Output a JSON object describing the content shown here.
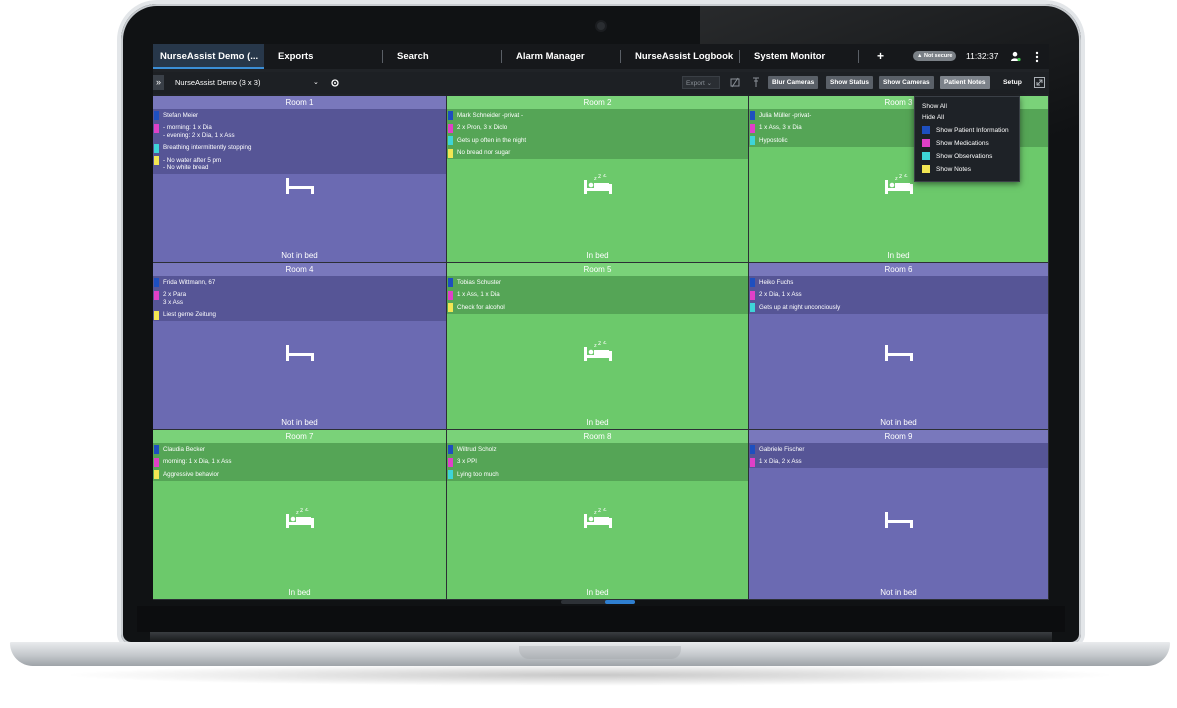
{
  "tabs": [
    {
      "label": "NurseAssist Demo (..."
    },
    {
      "label": "Exports"
    },
    {
      "label": "Search"
    },
    {
      "label": "Alarm Manager"
    },
    {
      "label": "NurseAssist Logbook"
    },
    {
      "label": "System Monitor"
    },
    {
      "label": "+"
    }
  ],
  "status": {
    "not_secure": "Not secure",
    "time": "11:32:37"
  },
  "toolbar": {
    "view_name": "NurseAssist Demo (3 x 3)",
    "export_label": "Export",
    "blur_cameras": "Blur Cameras",
    "show_status": "Show Status",
    "show_cameras": "Show Cameras",
    "patient_notes": "Patient Notes",
    "setup": "Setup"
  },
  "dropdown": {
    "show_all": "Show All",
    "hide_all": "Hide All",
    "items": [
      {
        "label": "Show Patient Information",
        "color": "#1e4fbf"
      },
      {
        "label": "Show Medications",
        "color": "#e040c8"
      },
      {
        "label": "Show Observations",
        "color": "#3ed4d8"
      },
      {
        "label": "Show Notes",
        "color": "#f2e653"
      }
    ]
  },
  "rooms": [
    {
      "title": "Room 1",
      "status": "Not in bed",
      "state": "out",
      "rows": [
        {
          "color": "blue",
          "lines": [
            "Stefan Meier"
          ]
        },
        {
          "color": "magenta",
          "lines": [
            "- morning: 1 x Dia",
            "- evening: 2 x Dia, 1 x Ass"
          ]
        },
        {
          "color": "cyan",
          "lines": [
            "Breathing intermittently stopping"
          ]
        },
        {
          "color": "yellow",
          "lines": [
            "- No water after 5 pm",
            "- No white bread"
          ]
        }
      ]
    },
    {
      "title": "Room 2",
      "status": "In bed",
      "state": "in",
      "rows": [
        {
          "color": "blue",
          "lines": [
            "Mark Schneider -privat -"
          ]
        },
        {
          "color": "magenta",
          "lines": [
            "2 x Pron, 3 x Diclo"
          ]
        },
        {
          "color": "cyan",
          "lines": [
            "Gets up often in the night"
          ]
        },
        {
          "color": "yellow",
          "lines": [
            "No bread nor sugar"
          ]
        }
      ]
    },
    {
      "title": "Room 3",
      "status": "In bed",
      "state": "in",
      "rows": [
        {
          "color": "blue",
          "lines": [
            "Julia Müller -privat-"
          ]
        },
        {
          "color": "magenta",
          "lines": [
            "1 x Ass, 3 x Dia"
          ]
        },
        {
          "color": "cyan",
          "lines": [
            "Hypostolic"
          ]
        }
      ]
    },
    {
      "title": "Room 4",
      "status": "Not in bed",
      "state": "out",
      "rows": [
        {
          "color": "blue",
          "lines": [
            "Frida Wittmann, 67"
          ]
        },
        {
          "color": "magenta",
          "lines": [
            "2 x Para",
            "3 x Ass"
          ]
        },
        {
          "color": "yellow",
          "lines": [
            "Liest gerne Zeitung"
          ]
        }
      ]
    },
    {
      "title": "Room 5",
      "status": "In bed",
      "state": "in",
      "rows": [
        {
          "color": "blue",
          "lines": [
            "Tobias Schuster"
          ]
        },
        {
          "color": "magenta",
          "lines": [
            "1 x Ass, 1 x Dia"
          ]
        },
        {
          "color": "yellow",
          "lines": [
            "Check for alcohol"
          ]
        }
      ]
    },
    {
      "title": "Room 6",
      "status": "Not in bed",
      "state": "out",
      "rows": [
        {
          "color": "blue",
          "lines": [
            "Heiko Fuchs"
          ]
        },
        {
          "color": "magenta",
          "lines": [
            "2 x Dia, 1 x Ass"
          ]
        },
        {
          "color": "cyan",
          "lines": [
            "Gets up at night unconciously"
          ]
        }
      ]
    },
    {
      "title": "Room 7",
      "status": "In bed",
      "state": "in",
      "rows": [
        {
          "color": "blue",
          "lines": [
            "Claudia Becker"
          ]
        },
        {
          "color": "magenta",
          "lines": [
            "morning: 1 x Dia, 1 x Ass"
          ]
        },
        {
          "color": "yellow",
          "lines": [
            "Aggressive behavior"
          ]
        }
      ]
    },
    {
      "title": "Room 8",
      "status": "In bed",
      "state": "in",
      "rows": [
        {
          "color": "blue",
          "lines": [
            "Wiltrud Scholz"
          ]
        },
        {
          "color": "magenta",
          "lines": [
            "3 x PPI"
          ]
        },
        {
          "color": "cyan",
          "lines": [
            "Lying too much"
          ]
        }
      ]
    },
    {
      "title": "Room 9",
      "status": "Not in bed",
      "state": "out",
      "rows": [
        {
          "color": "blue",
          "lines": [
            "Gabriele Fischer"
          ]
        },
        {
          "color": "magenta",
          "lines": [
            "1 x Dia, 2 x Ass"
          ]
        }
      ]
    }
  ]
}
